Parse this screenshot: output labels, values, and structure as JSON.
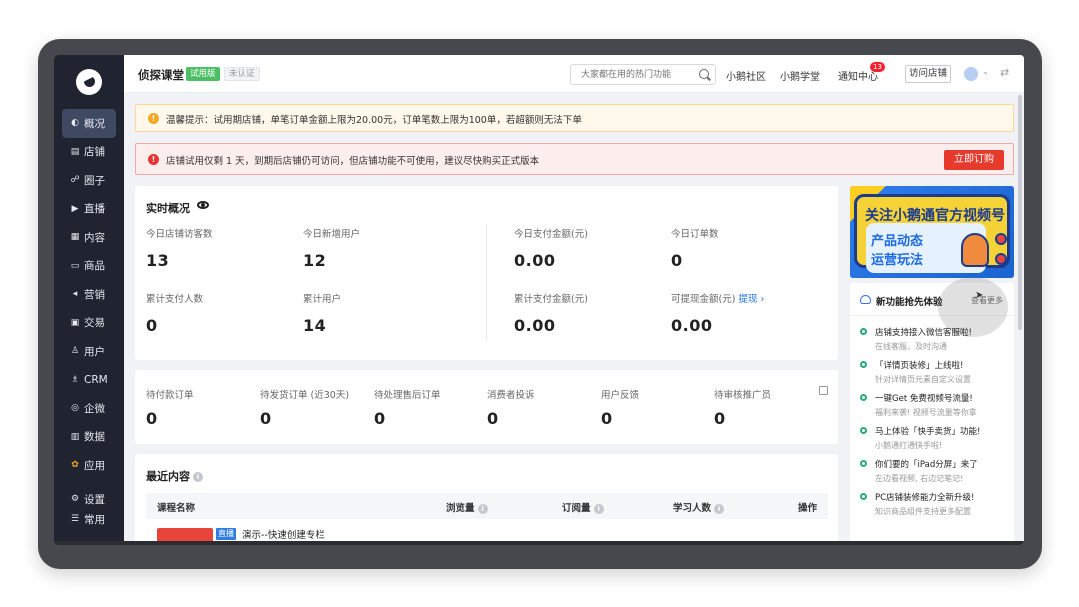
{
  "sidebar": {
    "items": [
      {
        "label": "概况",
        "icon": "pie-icon",
        "glyph": "◐"
      },
      {
        "label": "店铺",
        "icon": "store-icon",
        "glyph": "▤"
      },
      {
        "label": "圈子",
        "icon": "group-icon",
        "glyph": "☍"
      },
      {
        "label": "直播",
        "icon": "live-icon",
        "glyph": "▶"
      },
      {
        "label": "内容",
        "icon": "content-icon",
        "glyph": "▦"
      },
      {
        "label": "商品",
        "icon": "goods-icon",
        "glyph": "▭"
      },
      {
        "label": "营销",
        "icon": "marketing-icon",
        "glyph": "◂"
      },
      {
        "label": "交易",
        "icon": "trade-icon",
        "glyph": "▣"
      },
      {
        "label": "用户",
        "icon": "user-icon",
        "glyph": "♙"
      },
      {
        "label": "CRM",
        "icon": "crm-icon",
        "glyph": "♗"
      },
      {
        "label": "企微",
        "icon": "wecom-icon",
        "glyph": "◎"
      },
      {
        "label": "数据",
        "icon": "data-icon",
        "glyph": "▥"
      },
      {
        "label": "应用",
        "icon": "apps-icon",
        "glyph": "✿"
      }
    ],
    "bottom": [
      {
        "label": "设置",
        "icon": "gear-icon",
        "glyph": "⚙"
      },
      {
        "label": "常用",
        "icon": "list-icon",
        "glyph": "☰"
      }
    ]
  },
  "header": {
    "shop_name": "侦探课堂",
    "badge_trial": "试用版",
    "badge_unverified": "未认证",
    "search_placeholder": "大家都在用的热门功能",
    "links": [
      "小鹅社区",
      "小鹅学堂",
      "通知中心"
    ],
    "notify_count": "13",
    "visit_shop": "访问店铺"
  },
  "alerts": {
    "warning": "温馨提示：试用期店铺，单笔订单金额上限为20.00元，订单笔数上限为100单，若超额则无法下单",
    "error": "店铺试用仅剩 1 天，到期后店铺仍可访问，但店铺功能不可使用，建议尽快购买正式版本",
    "buy_button": "立即订购"
  },
  "realtime": {
    "title": "实时概况",
    "stats": [
      {
        "label": "今日店铺访客数",
        "value": "13"
      },
      {
        "label": "今日新增用户",
        "value": "12"
      },
      {
        "label": "今日支付金额(元)",
        "value": "0.00"
      },
      {
        "label": "今日订单数",
        "value": "0"
      },
      {
        "label": "累计支付人数",
        "value": "0"
      },
      {
        "label": "累计用户",
        "value": "14"
      },
      {
        "label": "累计支付金额(元)",
        "value": "0.00"
      },
      {
        "label": "可提现金额(元)",
        "value": "0.00",
        "link": "提现 ›"
      }
    ]
  },
  "orders": {
    "stats": [
      {
        "label": "待付款订单",
        "value": "0"
      },
      {
        "label": "待发货订单 (近30天)",
        "value": "0"
      },
      {
        "label": "待处理售后订单",
        "value": "0"
      },
      {
        "label": "消费者投诉",
        "value": "0"
      },
      {
        "label": "用户反馈",
        "value": "0"
      },
      {
        "label": "待审核推广员",
        "value": "0"
      }
    ]
  },
  "recent": {
    "title": "最近内容",
    "columns": [
      "课程名称",
      "浏览量",
      "订阅量",
      "学习人数",
      "操作"
    ],
    "rows": [
      {
        "tag": "直播",
        "title": "演示--快速创建专栏"
      }
    ]
  },
  "banner": {
    "line1": "关注小鹅通官方视频号",
    "line2": "产品动态 运营玩法"
  },
  "new_features": {
    "title": "新功能抢先体验",
    "more": "查看更多",
    "items": [
      {
        "title": "店铺支持接入微信客服啦!",
        "desc": "在线客服、及时沟通"
      },
      {
        "title": "「详情页装修」上线啦!",
        "desc": "针对详情页元素自定义设置"
      },
      {
        "title": "一键Get 免费视频号流量!",
        "desc": "福利来袭! 视频号流量等你拿"
      },
      {
        "title": "马上体验「快手卖货」功能!",
        "desc": "小鹅通打通快手啦!"
      },
      {
        "title": "你们要的「iPad分屏」来了",
        "desc": "左边看视频, 右边记笔记!"
      },
      {
        "title": "PC店铺装修能力全新升级!",
        "desc": "知识商品组件支持更多配置"
      }
    ]
  },
  "colors": {
    "sidebar_bg": "#1f2430",
    "primary_red": "#e63a2d",
    "link_blue": "#1f6feb",
    "success_green": "#2aa876"
  }
}
